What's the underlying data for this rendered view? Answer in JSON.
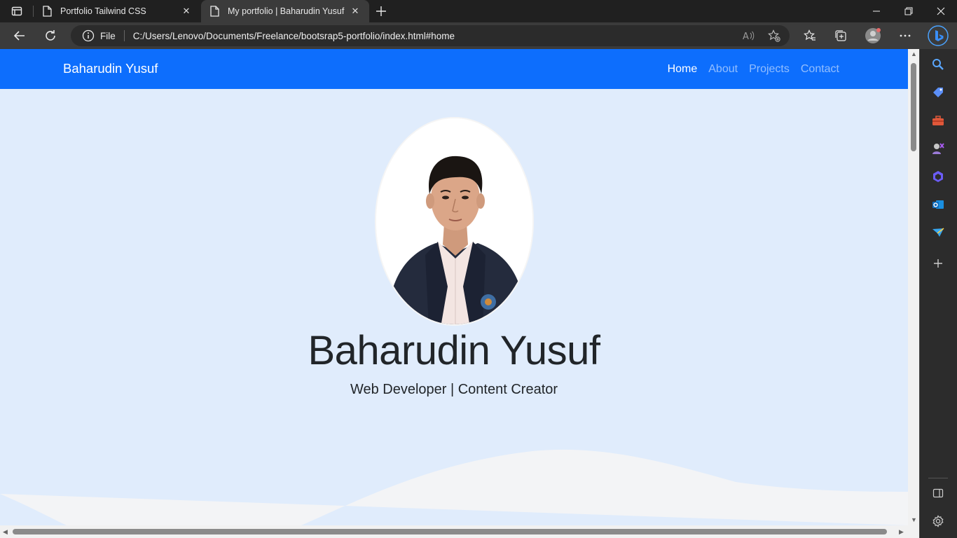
{
  "browser": {
    "tabs": [
      {
        "title": "Portfolio Tailwind CSS",
        "active": false
      },
      {
        "title": "My portfolio | Baharudin Yusuf",
        "active": true
      }
    ],
    "address": {
      "scheme_label": "File",
      "url": "C:/Users/Lenovo/Documents/Freelance/bootsrap5-portfolio/index.html#home"
    },
    "sidebar_icons": [
      "search-icon",
      "tag-icon",
      "toolbox-icon",
      "games-icon",
      "office-icon",
      "outlook-icon",
      "send-icon",
      "add-icon",
      "split-screen-icon",
      "settings-icon"
    ]
  },
  "page": {
    "navbar": {
      "brand": "Baharudin Yusuf",
      "links": [
        "Home",
        "About",
        "Projects",
        "Contact"
      ],
      "active_link": "Home"
    },
    "hero": {
      "name": "Baharudin Yusuf",
      "subtitle": "Web Developer | Content Creator"
    }
  },
  "colors": {
    "navbar": "#0d6efd",
    "hero_bg": "#e0ecfc",
    "wave": "#f3f4f6"
  }
}
